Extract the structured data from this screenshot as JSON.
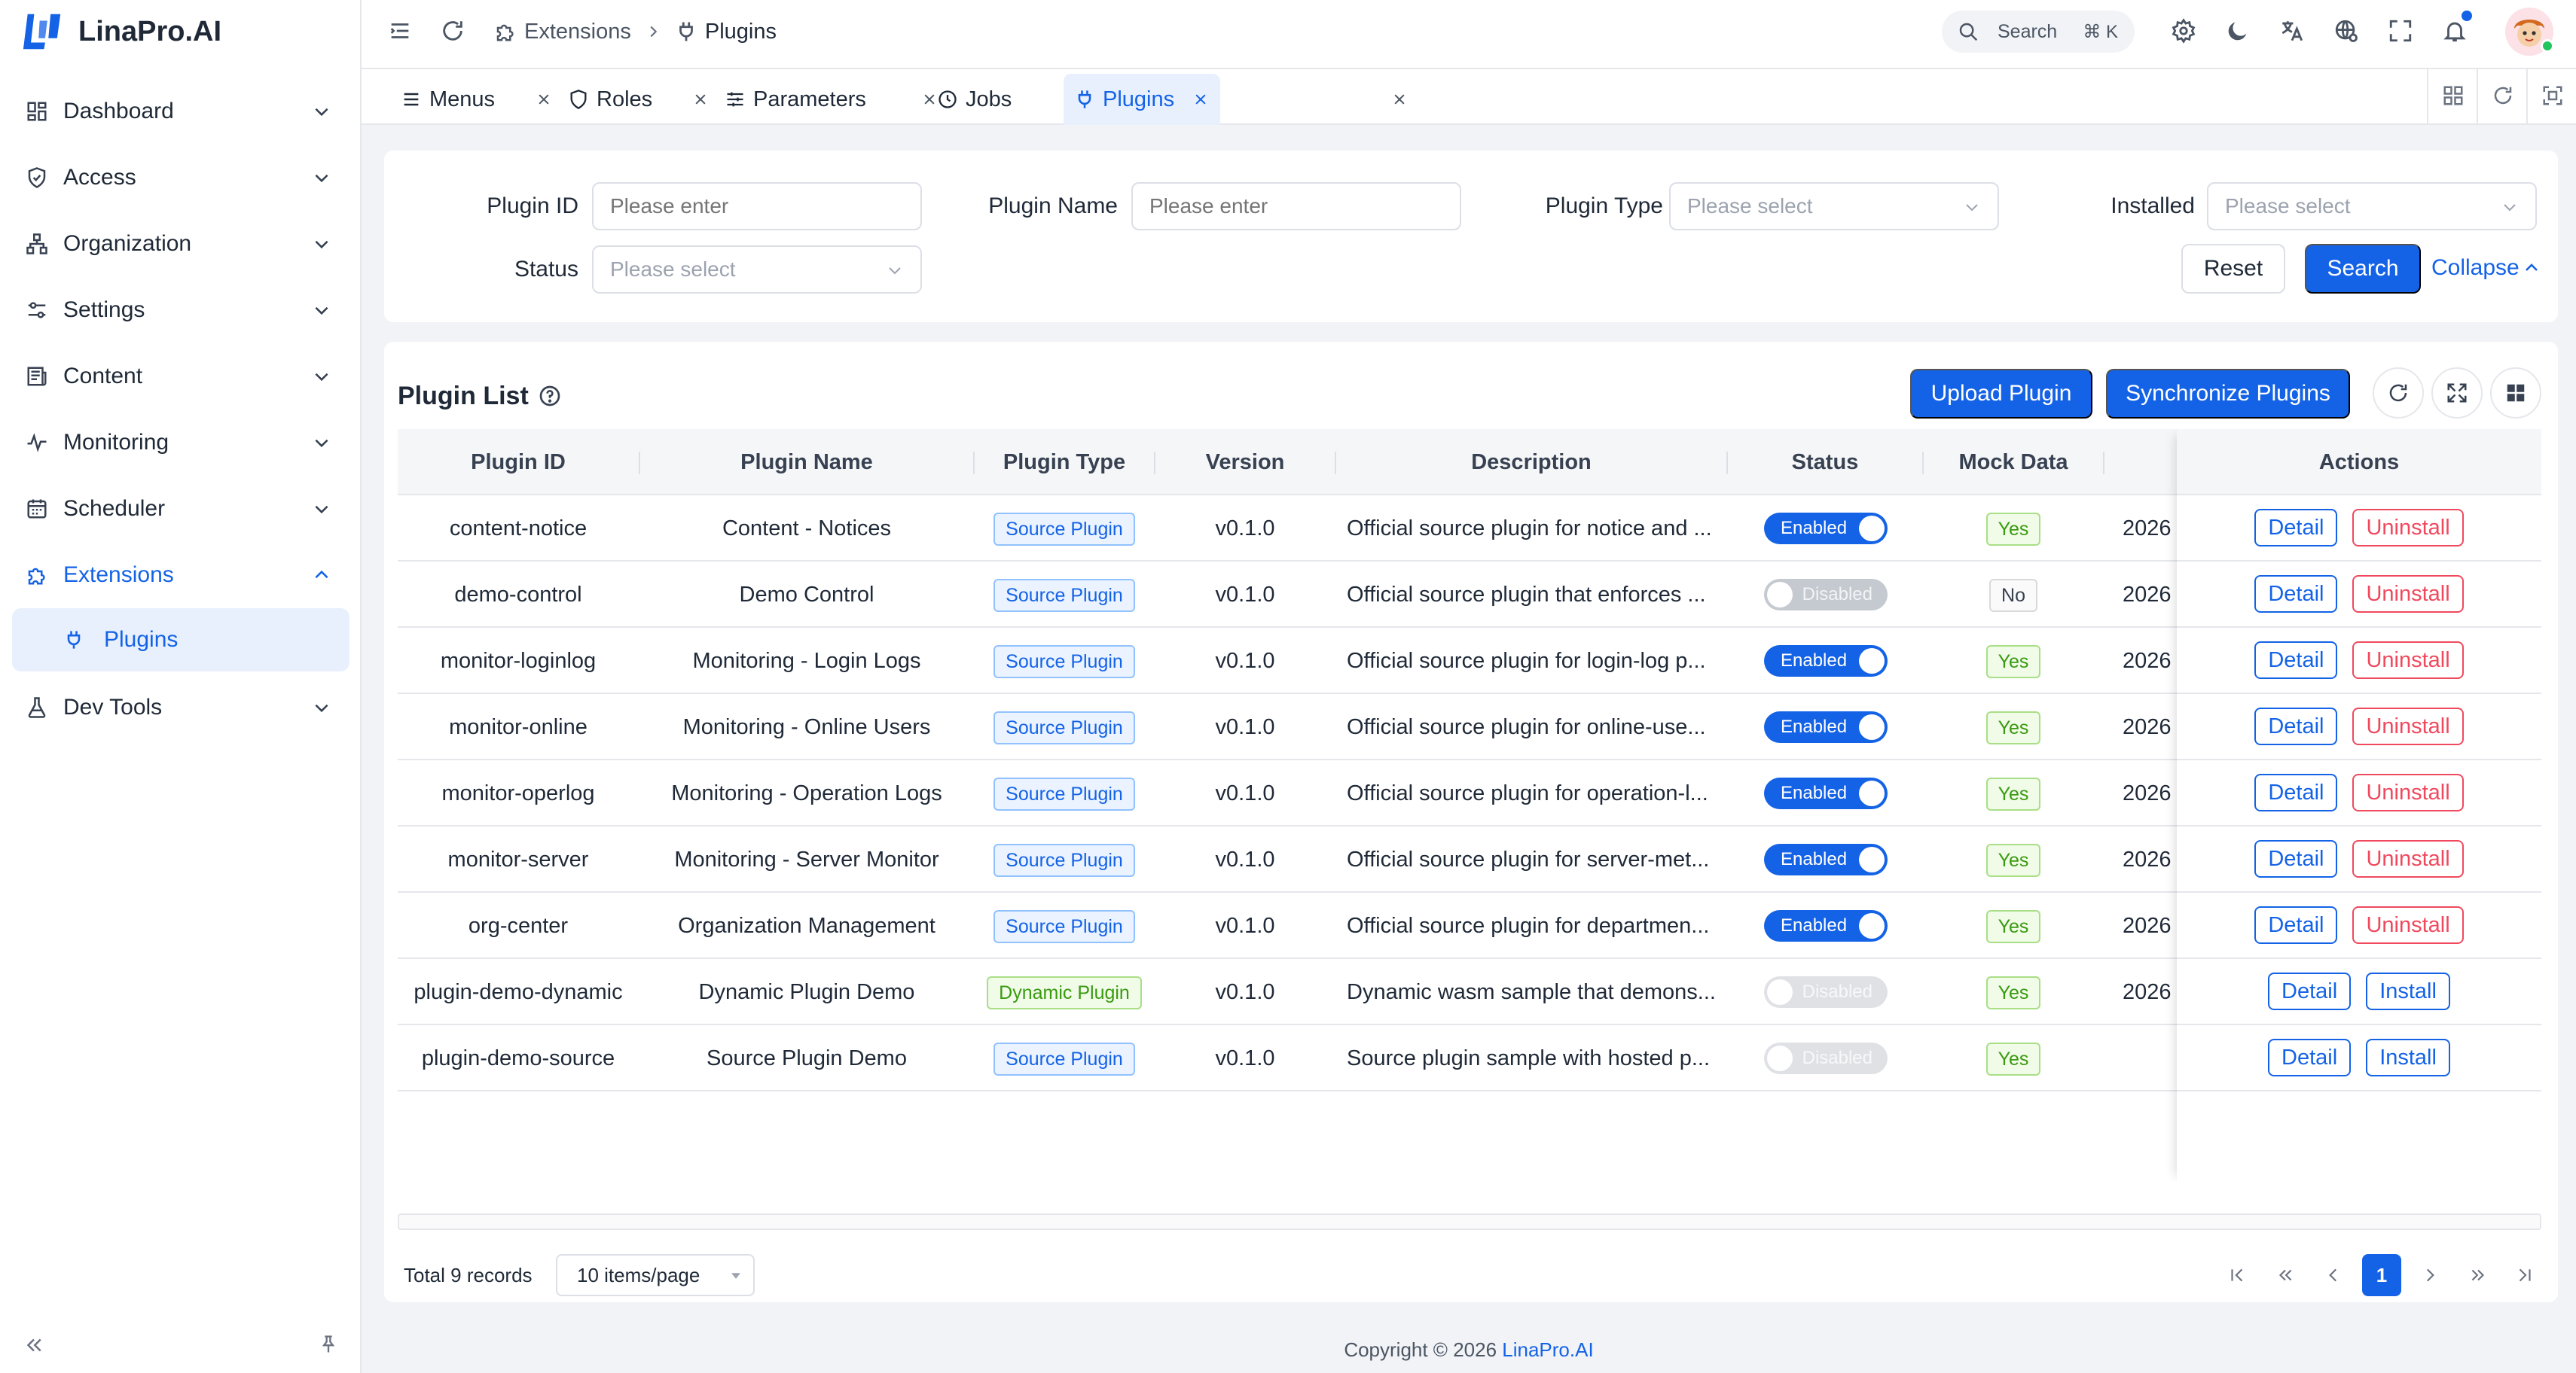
{
  "app": {
    "name": "LinaPro.AI"
  },
  "sidebar": {
    "items": [
      {
        "label": "Dashboard"
      },
      {
        "label": "Access"
      },
      {
        "label": "Organization"
      },
      {
        "label": "Settings"
      },
      {
        "label": "Content"
      },
      {
        "label": "Monitoring"
      },
      {
        "label": "Scheduler"
      },
      {
        "label": "Extensions"
      },
      {
        "label": "Dev Tools"
      }
    ],
    "sub_item": {
      "label": "Plugins"
    }
  },
  "header": {
    "breadcrumb": [
      "Extensions",
      "Plugins"
    ],
    "search_placeholder": "Search",
    "search_shortcut": "⌘ K"
  },
  "tabs": [
    {
      "label": "Menus"
    },
    {
      "label": "Roles"
    },
    {
      "label": "Parameters"
    },
    {
      "label": "Jobs"
    },
    {
      "label": "Plugins"
    }
  ],
  "filters": {
    "plugin_id": {
      "label": "Plugin ID",
      "placeholder": "Please enter"
    },
    "plugin_name": {
      "label": "Plugin Name",
      "placeholder": "Please enter"
    },
    "plugin_type": {
      "label": "Plugin Type",
      "placeholder": "Please select"
    },
    "installed": {
      "label": "Installed",
      "placeholder": "Please select"
    },
    "status": {
      "label": "Status",
      "placeholder": "Please select"
    },
    "reset_label": "Reset",
    "search_label": "Search",
    "collapse_label": "Collapse"
  },
  "table": {
    "title": "Plugin List",
    "upload_label": "Upload Plugin",
    "sync_label": "Synchronize Plugins",
    "columns": {
      "plugin_id": "Plugin ID",
      "plugin_name": "Plugin Name",
      "plugin_type": "Plugin Type",
      "version": "Version",
      "description": "Description",
      "status": "Status",
      "mock_data": "Mock Data",
      "actions": "Actions"
    },
    "rows": [
      {
        "id": "content-notice",
        "name": "Content - Notices",
        "type": "Source Plugin",
        "type_kind": "source",
        "version": "v0.1.0",
        "description": "Official source plugin for notice and ...",
        "status": "Enabled",
        "mock": "Yes",
        "date": "2026",
        "primary_action": "Detail",
        "secondary_action": "Uninstall"
      },
      {
        "id": "demo-control",
        "name": "Demo Control",
        "type": "Source Plugin",
        "type_kind": "source",
        "version": "v0.1.0",
        "description": "Official source plugin that enforces ...",
        "status": "Disabled",
        "mock": "No",
        "date": "2026",
        "primary_action": "Detail",
        "secondary_action": "Uninstall"
      },
      {
        "id": "monitor-loginlog",
        "name": "Monitoring - Login Logs",
        "type": "Source Plugin",
        "type_kind": "source",
        "version": "v0.1.0",
        "description": "Official source plugin for login-log p...",
        "status": "Enabled",
        "mock": "Yes",
        "date": "2026",
        "primary_action": "Detail",
        "secondary_action": "Uninstall"
      },
      {
        "id": "monitor-online",
        "name": "Monitoring - Online Users",
        "type": "Source Plugin",
        "type_kind": "source",
        "version": "v0.1.0",
        "description": "Official source plugin for online-use...",
        "status": "Enabled",
        "mock": "Yes",
        "date": "2026",
        "primary_action": "Detail",
        "secondary_action": "Uninstall"
      },
      {
        "id": "monitor-operlog",
        "name": "Monitoring - Operation Logs",
        "type": "Source Plugin",
        "type_kind": "source",
        "version": "v0.1.0",
        "description": "Official source plugin for operation-l...",
        "status": "Enabled",
        "mock": "Yes",
        "date": "2026",
        "primary_action": "Detail",
        "secondary_action": "Uninstall"
      },
      {
        "id": "monitor-server",
        "name": "Monitoring - Server Monitor",
        "type": "Source Plugin",
        "type_kind": "source",
        "version": "v0.1.0",
        "description": "Official source plugin for server-met...",
        "status": "Enabled",
        "mock": "Yes",
        "date": "2026",
        "primary_action": "Detail",
        "secondary_action": "Uninstall"
      },
      {
        "id": "org-center",
        "name": "Organization Management",
        "type": "Source Plugin",
        "type_kind": "source",
        "version": "v0.1.0",
        "description": "Official source plugin for departmen...",
        "status": "Enabled",
        "mock": "Yes",
        "date": "2026",
        "primary_action": "Detail",
        "secondary_action": "Uninstall"
      },
      {
        "id": "plugin-demo-dynamic",
        "name": "Dynamic Plugin Demo",
        "type": "Dynamic Plugin",
        "type_kind": "dynamic",
        "version": "v0.1.0",
        "description": "Dynamic wasm sample that demons...",
        "status": "Disabled",
        "mock": "Yes",
        "date": "2026",
        "primary_action": "Detail",
        "secondary_action": "Install"
      },
      {
        "id": "plugin-demo-source",
        "name": "Source Plugin Demo",
        "type": "Source Plugin",
        "type_kind": "source",
        "version": "v0.1.0",
        "description": "Source plugin sample with hosted p...",
        "status": "Disabled",
        "mock": "Yes",
        "date": "",
        "primary_action": "Detail",
        "secondary_action": "Install"
      }
    ]
  },
  "pagination": {
    "total": "Total 9 records",
    "page_size": "10 items/page",
    "current_page": "1"
  },
  "footer": {
    "text": "Copyright © 2026",
    "link": "LinaPro.AI"
  },
  "colors": {
    "primary": "#1463e6",
    "danger": "#f0495e",
    "success": "#3a9a10"
  }
}
